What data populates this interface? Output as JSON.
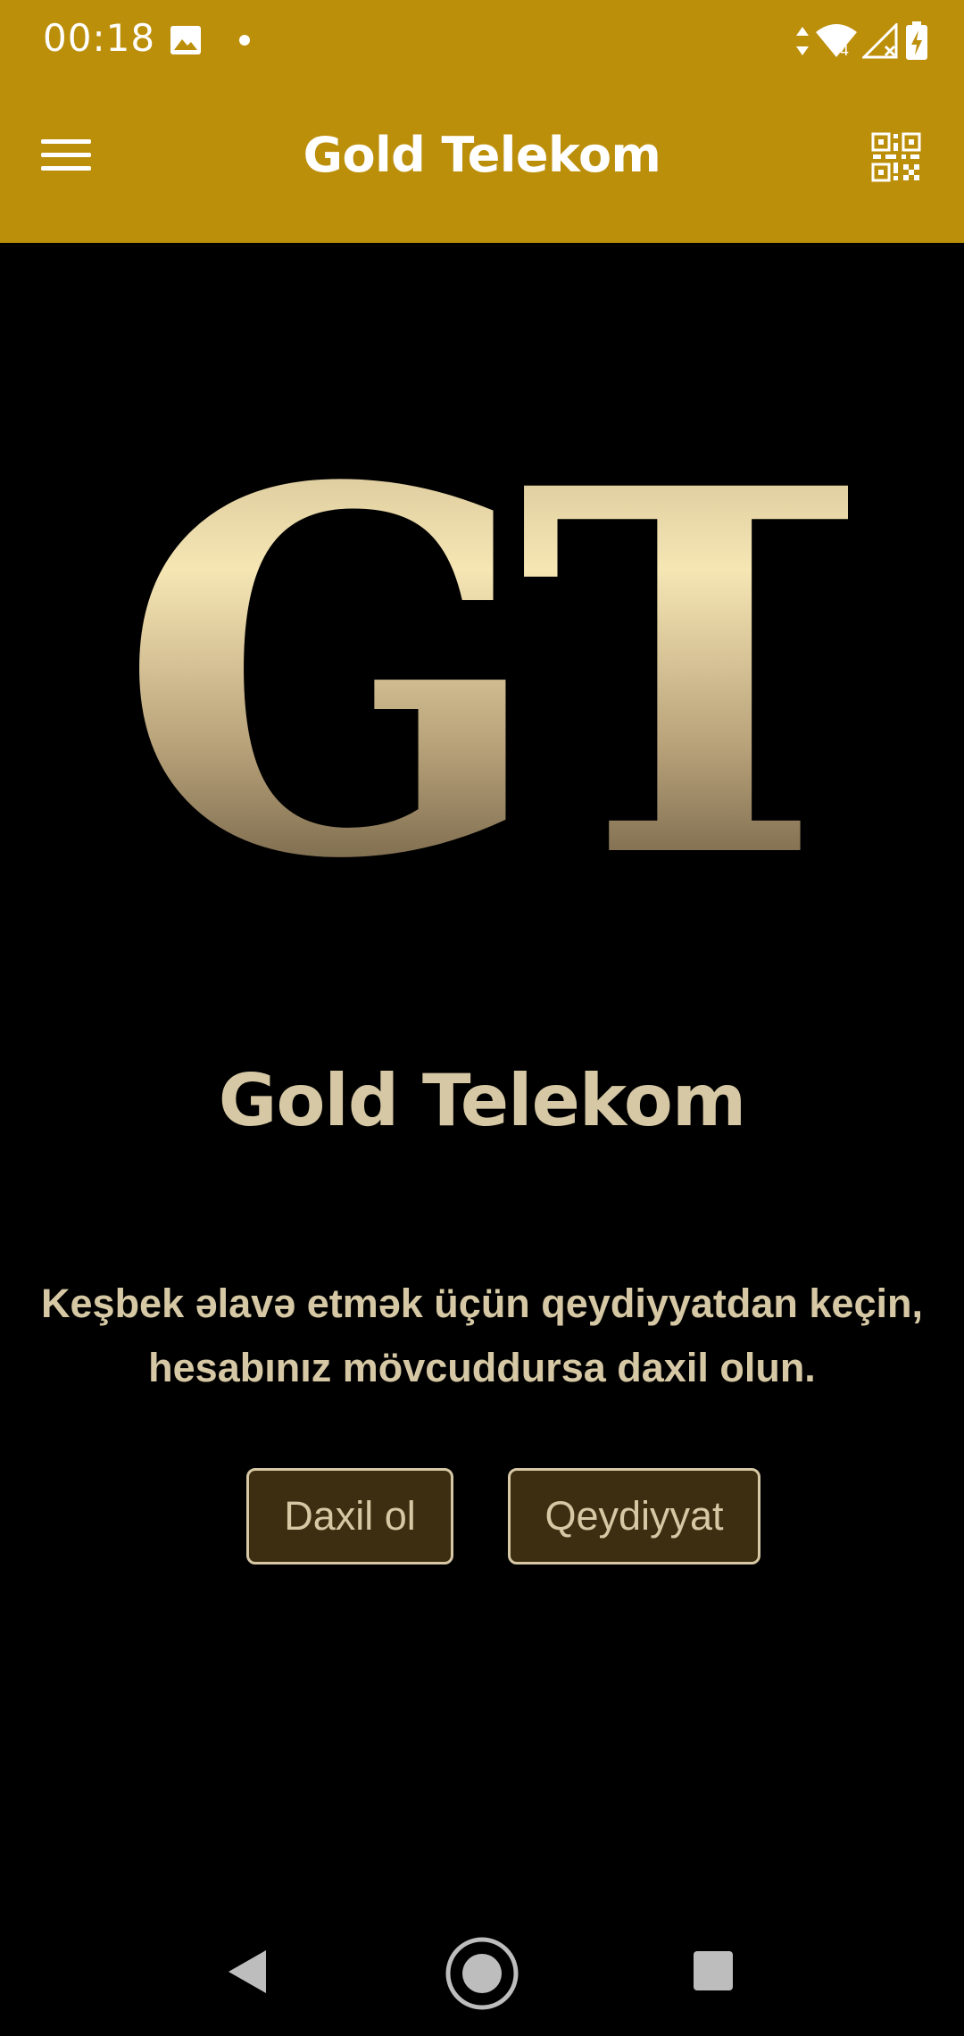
{
  "status_bar": {
    "time": "00:18",
    "icons": [
      "gallery-icon",
      "notification-dot",
      "data-arrows-icon",
      "wifi-icon",
      "signal-icon",
      "battery-charging-icon"
    ],
    "wifi_badge": "4"
  },
  "app_bar": {
    "title": "Gold Telekom",
    "left_icon": "menu-icon",
    "right_icon": "qr-code-icon"
  },
  "logo": {
    "text": "GT"
  },
  "main": {
    "brand_name": "Gold Telekom",
    "message": "Keşbek əlavə etmək üçün qeydiyyatdan keçin, hesabınız mövcuddursa daxil olun.",
    "login_label": "Daxil ol",
    "register_label": "Qeydiyyat"
  },
  "nav_bar": {
    "icons": [
      "back-icon",
      "home-icon",
      "recents-icon"
    ]
  },
  "colors": {
    "header": "#bc8f0b",
    "background": "#000000",
    "text_gold": "#d6c8a4",
    "button_fill": "#3d2e11"
  }
}
